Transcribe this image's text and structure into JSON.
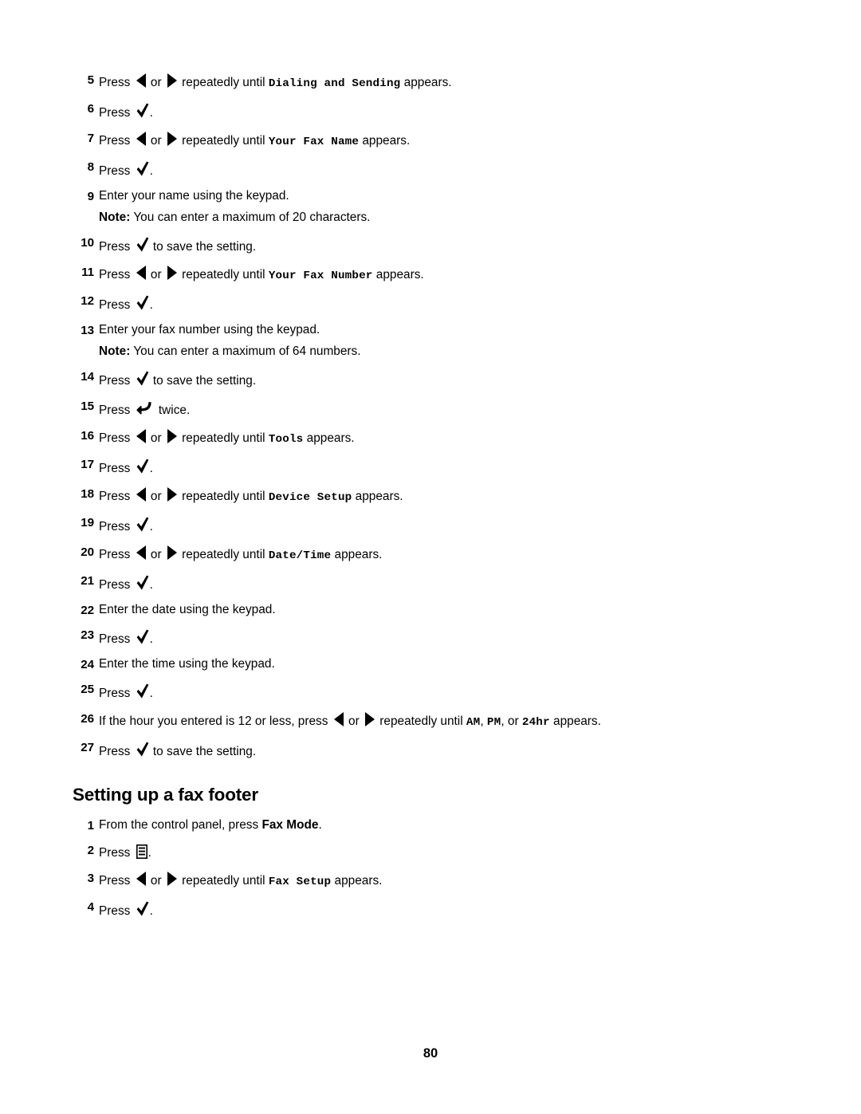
{
  "document": {
    "page_number": "80"
  },
  "procedure_continued": {
    "steps": [
      {
        "num": "5",
        "parts": [
          {
            "t": "text",
            "v": "Press "
          },
          {
            "t": "icon",
            "v": "left-arrow-icon"
          },
          {
            "t": "text",
            "v": " or "
          },
          {
            "t": "icon",
            "v": "right-arrow-icon"
          },
          {
            "t": "text",
            "v": " repeatedly until "
          },
          {
            "t": "ui",
            "v": "Dialing and Sending"
          },
          {
            "t": "text",
            "v": " appears."
          }
        ]
      },
      {
        "num": "6",
        "parts": [
          {
            "t": "text",
            "v": "Press "
          },
          {
            "t": "icon",
            "v": "check-icon"
          },
          {
            "t": "text",
            "v": "."
          }
        ]
      },
      {
        "num": "7",
        "parts": [
          {
            "t": "text",
            "v": "Press "
          },
          {
            "t": "icon",
            "v": "left-arrow-icon"
          },
          {
            "t": "text",
            "v": " or "
          },
          {
            "t": "icon",
            "v": "right-arrow-icon"
          },
          {
            "t": "text",
            "v": " repeatedly until "
          },
          {
            "t": "ui",
            "v": "Your Fax Name"
          },
          {
            "t": "text",
            "v": " appears."
          }
        ]
      },
      {
        "num": "8",
        "parts": [
          {
            "t": "text",
            "v": "Press "
          },
          {
            "t": "icon",
            "v": "check-icon"
          },
          {
            "t": "text",
            "v": "."
          }
        ]
      },
      {
        "num": "9",
        "parts": [
          {
            "t": "text",
            "v": "Enter your name using the keypad."
          }
        ],
        "note": {
          "label": "Note:",
          "text": " You can enter a maximum of 20 characters."
        }
      },
      {
        "num": "10",
        "parts": [
          {
            "t": "text",
            "v": "Press "
          },
          {
            "t": "icon",
            "v": "check-icon"
          },
          {
            "t": "text",
            "v": " to save the setting."
          }
        ]
      },
      {
        "num": "11",
        "parts": [
          {
            "t": "text",
            "v": "Press "
          },
          {
            "t": "icon",
            "v": "left-arrow-icon"
          },
          {
            "t": "text",
            "v": " or "
          },
          {
            "t": "icon",
            "v": "right-arrow-icon"
          },
          {
            "t": "text",
            "v": " repeatedly until "
          },
          {
            "t": "ui",
            "v": "Your Fax Number"
          },
          {
            "t": "text",
            "v": " appears."
          }
        ]
      },
      {
        "num": "12",
        "parts": [
          {
            "t": "text",
            "v": "Press "
          },
          {
            "t": "icon",
            "v": "check-icon"
          },
          {
            "t": "text",
            "v": "."
          }
        ]
      },
      {
        "num": "13",
        "parts": [
          {
            "t": "text",
            "v": "Enter your fax number using the keypad."
          }
        ],
        "note": {
          "label": "Note:",
          "text": " You can enter a maximum of 64 numbers."
        }
      },
      {
        "num": "14",
        "parts": [
          {
            "t": "text",
            "v": "Press "
          },
          {
            "t": "icon",
            "v": "check-icon"
          },
          {
            "t": "text",
            "v": " to save the setting."
          }
        ]
      },
      {
        "num": "15",
        "parts": [
          {
            "t": "text",
            "v": "Press "
          },
          {
            "t": "icon",
            "v": "back-icon"
          },
          {
            "t": "text",
            "v": " twice."
          }
        ]
      },
      {
        "num": "16",
        "parts": [
          {
            "t": "text",
            "v": "Press "
          },
          {
            "t": "icon",
            "v": "left-arrow-icon"
          },
          {
            "t": "text",
            "v": " or "
          },
          {
            "t": "icon",
            "v": "right-arrow-icon"
          },
          {
            "t": "text",
            "v": " repeatedly until "
          },
          {
            "t": "ui",
            "v": "Tools"
          },
          {
            "t": "text",
            "v": " appears."
          }
        ]
      },
      {
        "num": "17",
        "parts": [
          {
            "t": "text",
            "v": "Press "
          },
          {
            "t": "icon",
            "v": "check-icon"
          },
          {
            "t": "text",
            "v": "."
          }
        ]
      },
      {
        "num": "18",
        "parts": [
          {
            "t": "text",
            "v": "Press "
          },
          {
            "t": "icon",
            "v": "left-arrow-icon"
          },
          {
            "t": "text",
            "v": " or "
          },
          {
            "t": "icon",
            "v": "right-arrow-icon"
          },
          {
            "t": "text",
            "v": " repeatedly until "
          },
          {
            "t": "ui",
            "v": "Device Setup"
          },
          {
            "t": "text",
            "v": " appears."
          }
        ]
      },
      {
        "num": "19",
        "parts": [
          {
            "t": "text",
            "v": "Press "
          },
          {
            "t": "icon",
            "v": "check-icon"
          },
          {
            "t": "text",
            "v": "."
          }
        ]
      },
      {
        "num": "20",
        "parts": [
          {
            "t": "text",
            "v": "Press "
          },
          {
            "t": "icon",
            "v": "left-arrow-icon"
          },
          {
            "t": "text",
            "v": " or "
          },
          {
            "t": "icon",
            "v": "right-arrow-icon"
          },
          {
            "t": "text",
            "v": " repeatedly until "
          },
          {
            "t": "ui",
            "v": "Date/Time"
          },
          {
            "t": "text",
            "v": " appears."
          }
        ]
      },
      {
        "num": "21",
        "parts": [
          {
            "t": "text",
            "v": "Press "
          },
          {
            "t": "icon",
            "v": "check-icon"
          },
          {
            "t": "text",
            "v": "."
          }
        ]
      },
      {
        "num": "22",
        "parts": [
          {
            "t": "text",
            "v": "Enter the date using the keypad."
          }
        ]
      },
      {
        "num": "23",
        "parts": [
          {
            "t": "text",
            "v": "Press "
          },
          {
            "t": "icon",
            "v": "check-icon"
          },
          {
            "t": "text",
            "v": "."
          }
        ]
      },
      {
        "num": "24",
        "parts": [
          {
            "t": "text",
            "v": "Enter the time using the keypad."
          }
        ]
      },
      {
        "num": "25",
        "parts": [
          {
            "t": "text",
            "v": "Press "
          },
          {
            "t": "icon",
            "v": "check-icon"
          },
          {
            "t": "text",
            "v": "."
          }
        ]
      },
      {
        "num": "26",
        "parts": [
          {
            "t": "text",
            "v": "If the hour you entered is 12 or less, press "
          },
          {
            "t": "icon",
            "v": "left-arrow-icon"
          },
          {
            "t": "text",
            "v": " or "
          },
          {
            "t": "icon",
            "v": "right-arrow-icon"
          },
          {
            "t": "text",
            "v": " repeatedly until "
          },
          {
            "t": "ui",
            "v": "AM"
          },
          {
            "t": "text",
            "v": ", "
          },
          {
            "t": "ui",
            "v": "PM"
          },
          {
            "t": "text",
            "v": ", or "
          },
          {
            "t": "ui",
            "v": "24hr"
          },
          {
            "t": "text",
            "v": " appears."
          }
        ]
      },
      {
        "num": "27",
        "parts": [
          {
            "t": "text",
            "v": "Press "
          },
          {
            "t": "icon",
            "v": "check-icon"
          },
          {
            "t": "text",
            "v": " to save the setting."
          }
        ]
      }
    ]
  },
  "section_fax_footer": {
    "heading": "Setting up a fax footer",
    "steps": [
      {
        "num": "1",
        "parts": [
          {
            "t": "text",
            "v": "From the control panel, press "
          },
          {
            "t": "bold",
            "v": "Fax Mode"
          },
          {
            "t": "text",
            "v": "."
          }
        ]
      },
      {
        "num": "2",
        "parts": [
          {
            "t": "text",
            "v": "Press "
          },
          {
            "t": "icon",
            "v": "menu-icon"
          },
          {
            "t": "text",
            "v": "."
          }
        ]
      },
      {
        "num": "3",
        "parts": [
          {
            "t": "text",
            "v": "Press "
          },
          {
            "t": "icon",
            "v": "left-arrow-icon"
          },
          {
            "t": "text",
            "v": " or "
          },
          {
            "t": "icon",
            "v": "right-arrow-icon"
          },
          {
            "t": "text",
            "v": " repeatedly until "
          },
          {
            "t": "ui",
            "v": "Fax Setup"
          },
          {
            "t": "text",
            "v": " appears."
          }
        ]
      },
      {
        "num": "4",
        "parts": [
          {
            "t": "text",
            "v": "Press "
          },
          {
            "t": "icon",
            "v": "check-icon"
          },
          {
            "t": "text",
            "v": "."
          }
        ]
      }
    ]
  }
}
